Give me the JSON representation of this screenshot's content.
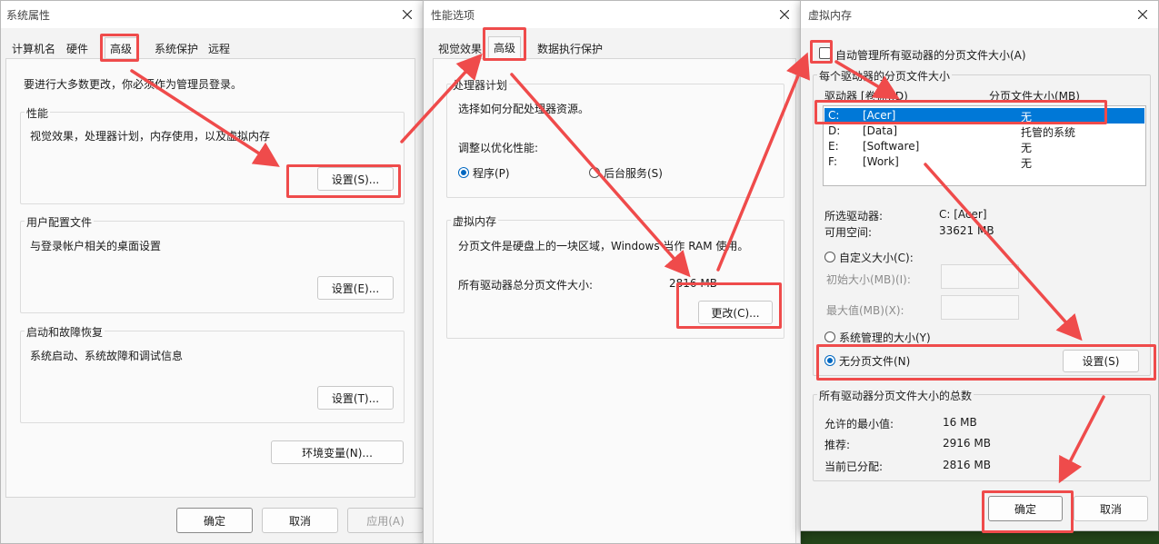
{
  "dialog1": {
    "title": "系统属性",
    "tabs": [
      "计算机名",
      "硬件",
      "高级",
      "系统保护",
      "远程"
    ],
    "admin_note": "要进行大多数更改，你必须作为管理员登录。",
    "performance": {
      "title": "性能",
      "desc": "视觉效果，处理器计划，内存使用，以及虚拟内存",
      "button": "设置(S)..."
    },
    "user_profiles": {
      "title": "用户配置文件",
      "desc": "与登录帐户相关的桌面设置",
      "button": "设置(E)..."
    },
    "startup": {
      "title": "启动和故障恢复",
      "desc": "系统启动、系统故障和调试信息",
      "button": "设置(T)..."
    },
    "env_button": "环境变量(N)...",
    "ok": "确定",
    "cancel": "取消",
    "apply": "应用(A)"
  },
  "dialog2": {
    "title": "性能选项",
    "tabs": [
      "视觉效果",
      "高级",
      "数据执行保护"
    ],
    "cpu": {
      "title": "处理器计划",
      "desc": "选择如何分配处理器资源。",
      "adjust": "调整以优化性能:",
      "programs": "程序(P)",
      "background": "后台服务(S)"
    },
    "vm": {
      "title": "虚拟内存",
      "desc": "分页文件是硬盘上的一块区域，Windows 当作 RAM 使用。",
      "total_label": "所有驱动器总分页文件大小:",
      "total_value": "2816 MB",
      "change_button": "更改(C)..."
    }
  },
  "dialog3": {
    "title": "虚拟内存",
    "auto_manage": "自动管理所有驱动器的分页文件大小(A)",
    "per_drive_title": "每个驱动器的分页文件大小",
    "col_drive": "驱动器 [卷标](D)",
    "col_size": "分页文件大小(MB)",
    "drives": [
      {
        "letter": "C:",
        "label": "[Acer]",
        "size": "无"
      },
      {
        "letter": "D:",
        "label": "[Data]",
        "size": "托管的系统"
      },
      {
        "letter": "E:",
        "label": "[Software]",
        "size": "无"
      },
      {
        "letter": "F:",
        "label": "[Work]",
        "size": "无"
      }
    ],
    "selected_drive_label": "所选驱动器:",
    "selected_drive_value": "C:  [Acer]",
    "free_space_label": "可用空间:",
    "free_space_value": "33621 MB",
    "custom_size": "自定义大小(C):",
    "initial_size": "初始大小(MB)(I):",
    "max_size": "最大值(MB)(X):",
    "system_managed": "系统管理的大小(Y)",
    "no_paging": "无分页文件(N)",
    "set_button": "设置(S)",
    "totals_title": "所有驱动器分页文件大小的总数",
    "min_label": "允许的最小值:",
    "min_value": "16 MB",
    "recommended_label": "推荐:",
    "recommended_value": "2916 MB",
    "allocated_label": "当前已分配:",
    "allocated_value": "2816 MB",
    "ok": "确定",
    "cancel": "取消"
  },
  "colors": {
    "annotation": "#ef4b4b",
    "selection": "#0078d7",
    "radio": "#0067c0"
  },
  "icons": {
    "close": "close-icon"
  }
}
